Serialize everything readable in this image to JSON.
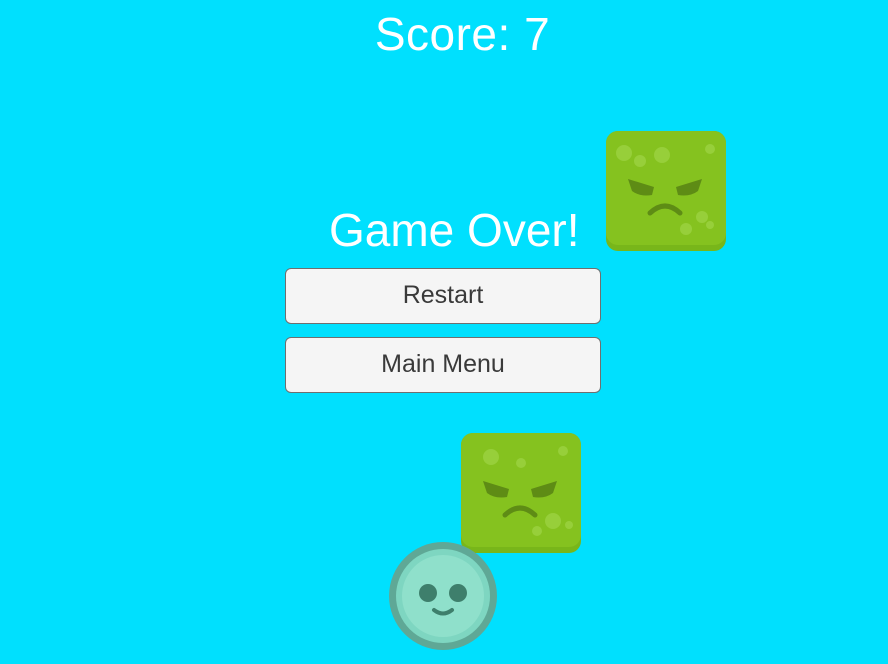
{
  "hud": {
    "score_text": "Score: 7"
  },
  "game_over": {
    "title": "Game Over!",
    "restart_label": "Restart",
    "main_menu_label": "Main Menu"
  },
  "sprites": {
    "enemy_icon": "angry-green-block-icon",
    "player_icon": "smiling-teal-ball-icon",
    "enemy_color": "#85c21f",
    "player_color": "#7ed6c1"
  },
  "colors": {
    "background": "#00e0fe",
    "text": "#ffffff",
    "button_bg": "#f5f5f5",
    "button_text": "#3a3a3a"
  }
}
